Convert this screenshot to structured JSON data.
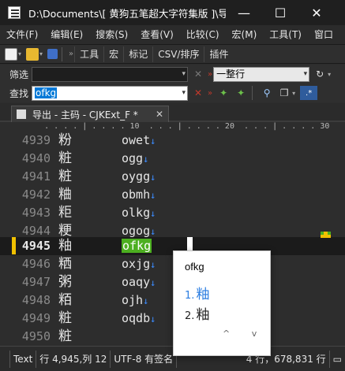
{
  "window": {
    "title": "D:\\Documents\\[ 黄狗五笔超大字符集版 ]\\导...",
    "min_glyph": "—",
    "max_glyph": "☐",
    "close_glyph": "✕"
  },
  "menu": [
    "文件(F)",
    "编辑(E)",
    "搜索(S)",
    "查看(V)",
    "比较(C)",
    "宏(M)",
    "工具(T)",
    "窗口"
  ],
  "toolbar": {
    "grip": "»",
    "buttons": [
      "工具",
      "宏",
      "标记",
      "CSV/排序",
      "插件"
    ]
  },
  "filter": {
    "label": "筛选",
    "value": "",
    "mode": "一整行",
    "arrow": "▾"
  },
  "find": {
    "label": "查找",
    "value": "ofkg",
    "regex_label": ".*"
  },
  "tab": {
    "label": "导出 - 主码 - CJKExt_F *",
    "close": "✕"
  },
  "ruler": "       . . . . | . . . . 10  . . . | . . . . 20  . . . | . . . . 30",
  "lines": [
    {
      "num": "4939",
      "hz": "粉",
      "code": "owet",
      "eol": "↓"
    },
    {
      "num": "4940",
      "hz": "粧",
      "code": "ogg",
      "eol": "↓"
    },
    {
      "num": "4941",
      "hz": "粧",
      "code": "oygg",
      "eol": "↓"
    },
    {
      "num": "4942",
      "hz": "粬",
      "code": "obmh",
      "eol": "↓"
    },
    {
      "num": "4943",
      "hz": "粔",
      "code": "olkg",
      "eol": "↓"
    },
    {
      "num": "4944",
      "hz": "粳",
      "code": "ogog",
      "eol": "↓"
    },
    {
      "num": "4945",
      "hz": "粙",
      "code": "ofkg",
      "eol": ""
    },
    {
      "num": "4946",
      "hz": "粞",
      "code": "oxjg",
      "eol": "↓"
    },
    {
      "num": "4947",
      "hz": "粥",
      "code": "oaqy",
      "eol": "↓"
    },
    {
      "num": "4948",
      "hz": "粨",
      "code": "ojh",
      "eol": "↓"
    },
    {
      "num": "4949",
      "hz": "粧",
      "code": "oqdb",
      "eol": "↓"
    },
    {
      "num": "4950",
      "hz": "粧",
      "code": "",
      "eol": ""
    }
  ],
  "ime": {
    "composition": "ofkg",
    "candidates": [
      {
        "n": "1.",
        "ch": "粙"
      },
      {
        "n": "2.",
        "ch": "粙"
      }
    ],
    "nav": "^ v"
  },
  "status": {
    "mode": "Text",
    "position": "行 4,945,列 12",
    "encoding": "UTF-8 有签名",
    "count": "4 行，678,831 行",
    "extra": "▭"
  },
  "colors": {
    "highlight": "#4caf20",
    "eol_arrow": "#3c8cff",
    "candidate_active": "#2b7de1",
    "gutter_mark": "#f0c000"
  }
}
